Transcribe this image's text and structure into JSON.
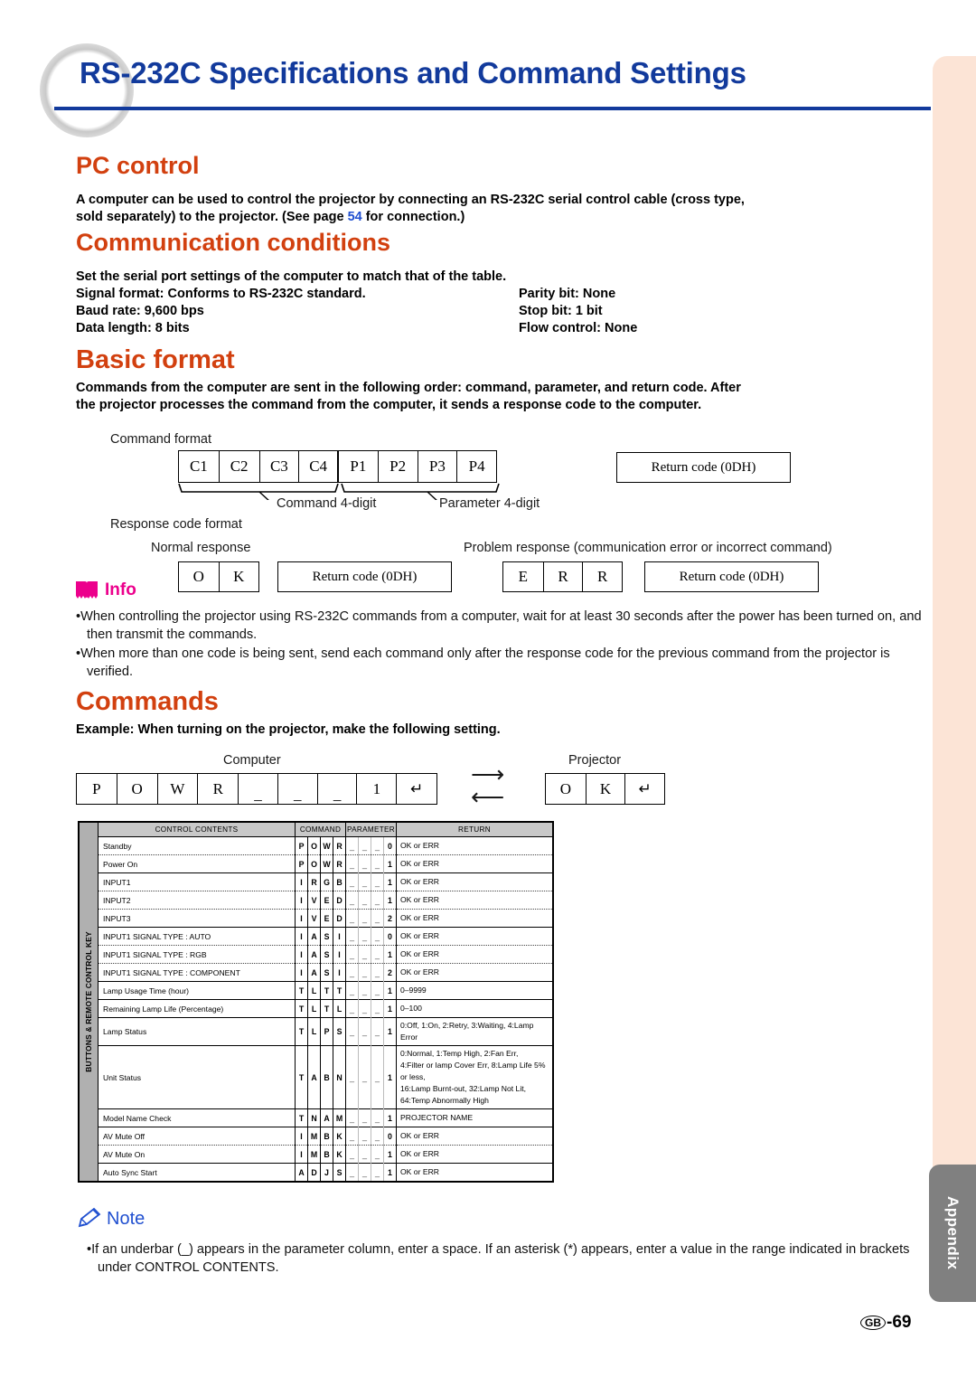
{
  "page": {
    "title": "RS-232C Specifications and Command Settings",
    "side_tab_label": "Appendix",
    "page_number": "-69",
    "page_number_prefix": "GB"
  },
  "pc_control": {
    "heading": "PC control",
    "body_line1": "A computer can be used to control the projector by connecting an RS-232C serial control cable (cross type,",
    "body_line2_a": "sold separately) to the projector. (See page ",
    "body_page_ref": "54",
    "body_line2_b": " for connection.)"
  },
  "communication_conditions": {
    "heading": "Communication conditions",
    "intro": "Set the serial port settings of the computer to match that of the table.",
    "rows": [
      {
        "left": "Signal format: Conforms to RS-232C standard.",
        "right": "Parity bit: None"
      },
      {
        "left": "Baud rate: 9,600 bps",
        "right": "Stop bit: 1 bit"
      },
      {
        "left": "Data length: 8 bits",
        "right": "Flow control: None"
      }
    ]
  },
  "basic_format": {
    "heading": "Basic format",
    "body_line1": "Commands from the computer are sent in the following order: command, parameter, and return code. After",
    "body_line2": "the projector processes the command from the computer, it sends a response code to the computer.",
    "command_format_label": "Command format",
    "command_cells": [
      "C1",
      "C2",
      "C3",
      "C4",
      "P1",
      "P2",
      "P3",
      "P4"
    ],
    "brace_command_label": "Command 4-digit",
    "brace_parameter_label": "Parameter 4-digit",
    "return_code_label": "Return code (0DH)",
    "response_code_format_label": "Response code format",
    "normal_response_label": "Normal response",
    "normal_cells": [
      "O",
      "K"
    ],
    "normal_return_code": "Return code (0DH)",
    "problem_response_label": "Problem response (communication error or incorrect command)",
    "problem_cells": [
      "E",
      "R",
      "R"
    ],
    "problem_return_code": "Return code (0DH)"
  },
  "info": {
    "icon": "open-book-icon",
    "label": "Info",
    "bullets": [
      "When controlling the projector using RS-232C commands from a computer, wait for at least 30 seconds after the power has been turned on, and then transmit the commands.",
      "When more than one code is being sent, send each command only after the response code for the previous command from the projector is verified."
    ]
  },
  "commands": {
    "heading": "Commands",
    "example_line": "Example: When turning on the projector, make the following setting.",
    "computer_label": "Computer",
    "projector_label": "Projector",
    "computer_cells": [
      "P",
      "O",
      "W",
      "R",
      "_",
      "_",
      "_",
      "1",
      "↵"
    ],
    "projector_cells": [
      "O",
      "K",
      "↵"
    ],
    "arrow_right": "⟶",
    "arrow_left": "⟵"
  },
  "command_table": {
    "side_label": "BUTTONS & REMOTE CONTROL KEY",
    "headers": [
      "CONTROL CONTENTS",
      "COMMAND",
      "PARAMETER",
      "RETURN"
    ],
    "rows": [
      {
        "contents": "Standby",
        "command": [
          "P",
          "O",
          "W",
          "R"
        ],
        "parameter": [
          "_",
          "_",
          "_",
          "0"
        ],
        "return": [
          "OK or ERR"
        ],
        "sep": "solid"
      },
      {
        "contents": "Power On",
        "command": [
          "P",
          "O",
          "W",
          "R"
        ],
        "parameter": [
          "_",
          "_",
          "_",
          "1"
        ],
        "return": [
          "OK or ERR"
        ],
        "sep": "dot"
      },
      {
        "contents": "INPUT1",
        "command": [
          "I",
          "R",
          "G",
          "B"
        ],
        "parameter": [
          "_",
          "_",
          "_",
          "1"
        ],
        "return": [
          "OK or ERR"
        ],
        "sep": "solid"
      },
      {
        "contents": "INPUT2",
        "command": [
          "I",
          "V",
          "E",
          "D"
        ],
        "parameter": [
          "_",
          "_",
          "_",
          "1"
        ],
        "return": [
          "OK or ERR"
        ],
        "sep": "dot"
      },
      {
        "contents": "INPUT3",
        "command": [
          "I",
          "V",
          "E",
          "D"
        ],
        "parameter": [
          "_",
          "_",
          "_",
          "2"
        ],
        "return": [
          "OK or ERR"
        ],
        "sep": "dot"
      },
      {
        "contents": "INPUT1 SIGNAL TYPE : AUTO",
        "command": [
          "I",
          "A",
          "S",
          "I"
        ],
        "parameter": [
          "_",
          "_",
          "_",
          "0"
        ],
        "return": [
          "OK or ERR"
        ],
        "sep": "solid"
      },
      {
        "contents": "INPUT1 SIGNAL TYPE : RGB",
        "command": [
          "I",
          "A",
          "S",
          "I"
        ],
        "parameter": [
          "_",
          "_",
          "_",
          "1"
        ],
        "return": [
          "OK or ERR"
        ],
        "sep": "dot"
      },
      {
        "contents": "INPUT1 SIGNAL TYPE : COMPONENT",
        "command": [
          "I",
          "A",
          "S",
          "I"
        ],
        "parameter": [
          "_",
          "_",
          "_",
          "2"
        ],
        "return": [
          "OK or ERR"
        ],
        "sep": "dot"
      },
      {
        "contents": "Lamp Usage Time (hour)",
        "command": [
          "T",
          "L",
          "T",
          "T"
        ],
        "parameter": [
          "_",
          "_",
          "_",
          "1"
        ],
        "return": [
          "0–9999"
        ],
        "sep": "solid"
      },
      {
        "contents": "Remaining Lamp Life (Percentage)",
        "command": [
          "T",
          "L",
          "T",
          "L"
        ],
        "parameter": [
          "_",
          "_",
          "_",
          "1"
        ],
        "return": [
          "0–100"
        ],
        "sep": "solid"
      },
      {
        "contents": "Lamp Status",
        "command": [
          "T",
          "L",
          "P",
          "S"
        ],
        "parameter": [
          "_",
          "_",
          "_",
          "1"
        ],
        "return": [
          "0:Off, 1:On, 2:Retry, 3:Waiting, 4:Lamp Error"
        ],
        "sep": "solid"
      },
      {
        "contents": "Unit Status",
        "command": [
          "T",
          "A",
          "B",
          "N"
        ],
        "parameter": [
          "_",
          "_",
          "_",
          "1"
        ],
        "return": [
          "0:Normal, 1:Temp High, 2:Fan Err,",
          "4:Filter or lamp Cover Err, 8:Lamp Life 5% or less,",
          "16:Lamp Burnt-out, 32:Lamp Not Lit,",
          "64:Temp Abnormally High"
        ],
        "sep": "solid"
      },
      {
        "contents": "Model Name Check",
        "command": [
          "T",
          "N",
          "A",
          "M"
        ],
        "parameter": [
          "_",
          "_",
          "_",
          "1"
        ],
        "return": [
          "PROJECTOR NAME"
        ],
        "sep": "solid"
      },
      {
        "contents": "AV Mute Off",
        "command": [
          "I",
          "M",
          "B",
          "K"
        ],
        "parameter": [
          "_",
          "_",
          "_",
          "0"
        ],
        "return": [
          "OK or ERR"
        ],
        "sep": "solid"
      },
      {
        "contents": "AV Mute On",
        "command": [
          "I",
          "M",
          "B",
          "K"
        ],
        "parameter": [
          "_",
          "_",
          "_",
          "1"
        ],
        "return": [
          "OK or ERR"
        ],
        "sep": "dot"
      },
      {
        "contents": "Auto Sync Start",
        "command": [
          "A",
          "D",
          "J",
          "S"
        ],
        "parameter": [
          "_",
          "_",
          "_",
          "1"
        ],
        "return": [
          "OK or ERR"
        ],
        "sep": "solid"
      }
    ]
  },
  "note": {
    "icon": "pencil-icon",
    "label": "Note",
    "bullets": [
      "If an underbar (_)  appears in the parameter column, enter a space. If an asterisk (*) appears, enter a value in the range indicated in brackets under CONTROL CONTENTS."
    ]
  },
  "colors": {
    "title_blue": "#123a9c",
    "heading_orange": "#d2400f",
    "info_magenta": "#ec008c",
    "note_blue": "#2150d0",
    "side_tab_beige": "#fce4d6",
    "appendix_gray": "#808080"
  }
}
